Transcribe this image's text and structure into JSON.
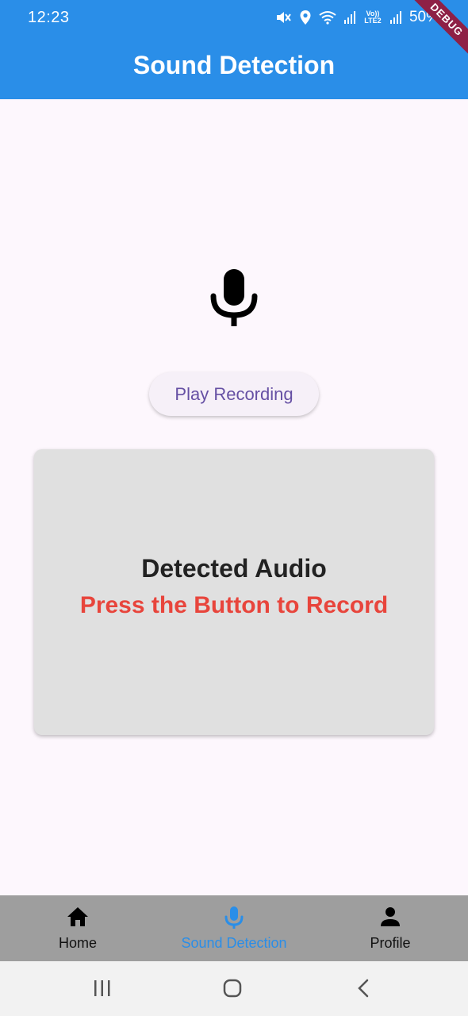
{
  "status_bar": {
    "time": "12:23",
    "battery": "50%",
    "lte_label": "Vo)) LTE2",
    "icons": [
      "mute-icon",
      "location-icon",
      "wifi-icon",
      "signal-icon",
      "signal-icon",
      "battery-icon"
    ]
  },
  "debug_banner": "DEBUG",
  "app_bar": {
    "title": "Sound Detection"
  },
  "main": {
    "mic_icon": "mic-icon",
    "play_button": "Play Recording",
    "card": {
      "title": "Detected Audio",
      "status": "Press the Button to Record"
    }
  },
  "bottom_nav": {
    "items": [
      {
        "label": "Home",
        "icon": "home-icon",
        "active": false
      },
      {
        "label": "Sound Detection",
        "icon": "mic-icon",
        "active": true
      },
      {
        "label": "Profile",
        "icon": "person-icon",
        "active": false
      }
    ]
  },
  "system_nav": {
    "icons": [
      "recent-apps-icon",
      "home-circle-icon",
      "back-icon"
    ]
  },
  "colors": {
    "app_bar": "#2a8ee8",
    "background": "#fdf7fd",
    "card": "#e0e0e0",
    "status_text": "#e8453c",
    "button_text": "#6650a4",
    "bottom_nav": "#9e9e9e",
    "active_nav": "#2a8ee8"
  }
}
